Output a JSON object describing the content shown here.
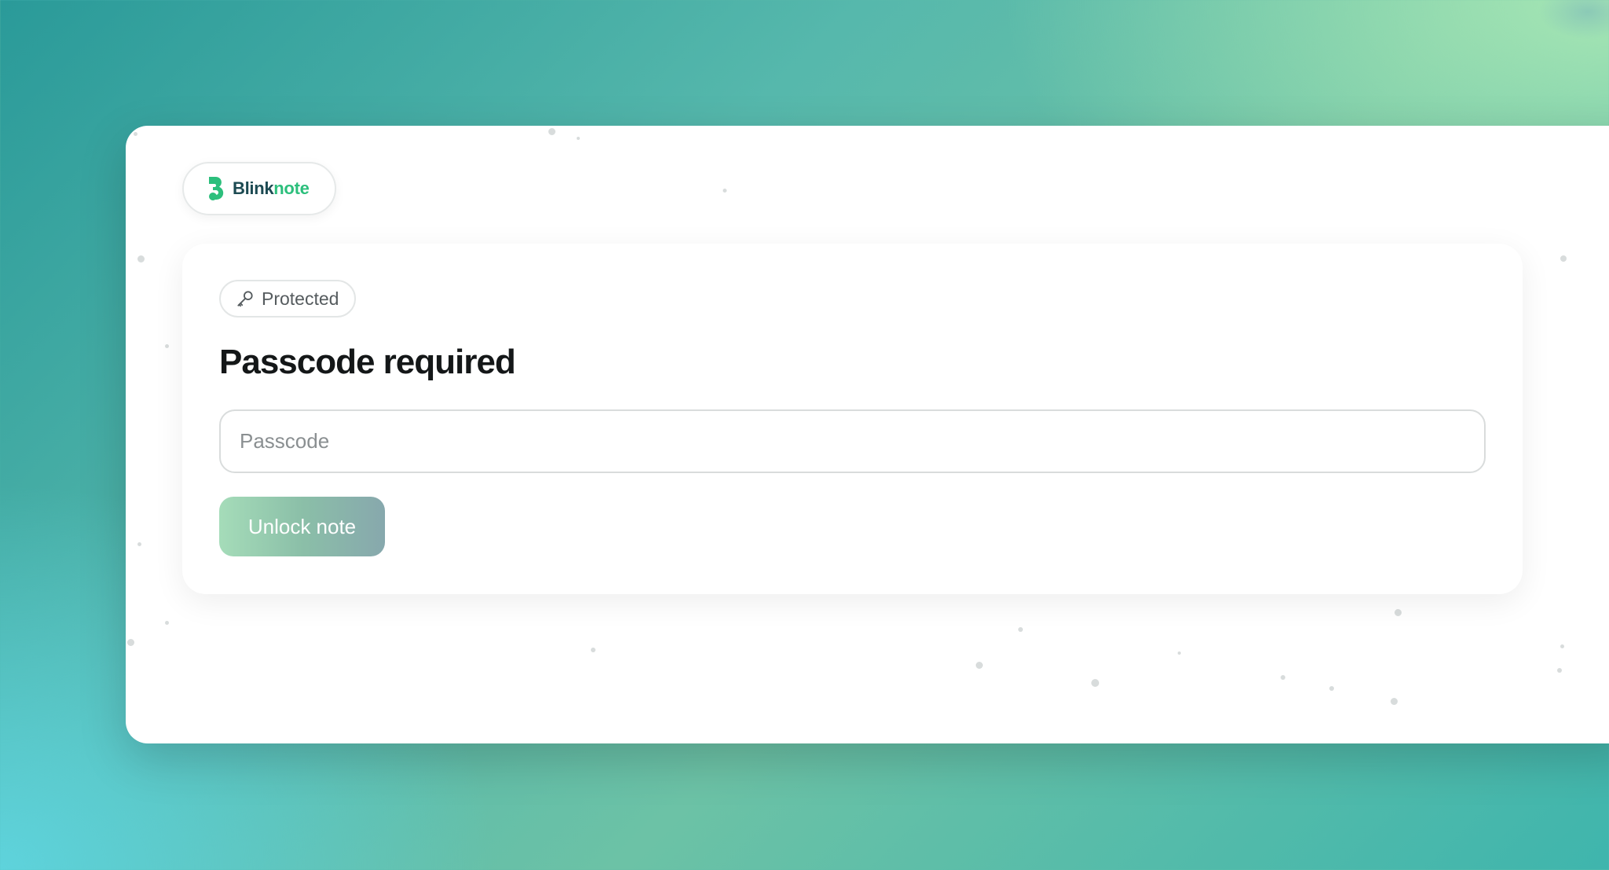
{
  "app": {
    "logo": {
      "brand_part1": "Blink",
      "brand_part2": "note",
      "icon": "blinknote-logo-icon",
      "color_dark": "#1c4a52",
      "color_accent": "#2cbf7c"
    }
  },
  "card": {
    "badge": {
      "icon": "key-icon",
      "label": "Protected"
    },
    "title": "Passcode required",
    "passcode_field": {
      "placeholder": "Passcode",
      "value": ""
    },
    "unlock_button": {
      "label": "Unlock note",
      "state": "disabled"
    }
  }
}
